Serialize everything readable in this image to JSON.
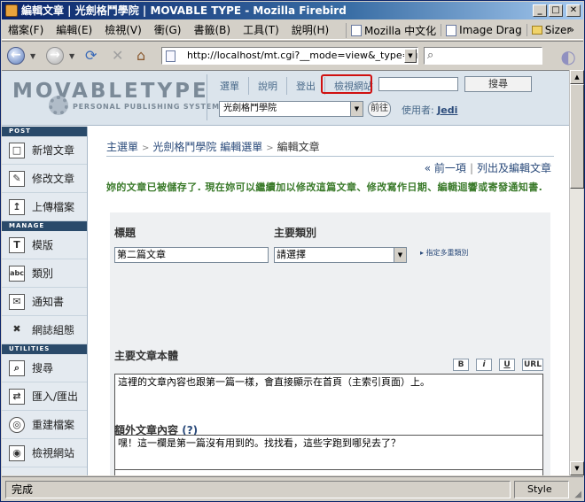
{
  "window": {
    "title": "編輯文章 | 光劍格鬥學院 | MOVABLE TYPE - Mozilla Firebird"
  },
  "menubar": {
    "items": [
      "檔案(F)",
      "編輯(E)",
      "檢視(V)",
      "衝(G)",
      "書籤(B)",
      "工具(T)",
      "說明(H)"
    ],
    "bookmarks": [
      "Mozilla 中文化",
      "Image Drag",
      "Sizer"
    ]
  },
  "navbar": {
    "url": "http://localhost/mt.cgi?__mode=view&_type=entry&"
  },
  "mt_header": {
    "logo": "MOVABLETYPE",
    "logo_sub": "PERSONAL PUBLISHING SYSTEM",
    "links": [
      "選單",
      "說明",
      "登出",
      "檢視網站"
    ],
    "search_button": "搜尋",
    "blog_select": "光劍格鬥學院",
    "go_button": "前往",
    "user_label": "使用者:",
    "user_name": "Jedi"
  },
  "sidebar": {
    "sections": {
      "post": "POST",
      "manage": "MANAGE",
      "utilities": "UTILITIES"
    },
    "post_items": [
      {
        "label": "新增文章",
        "icon": "new-entry-icon"
      },
      {
        "label": "修改文章",
        "icon": "edit-entry-icon"
      },
      {
        "label": "上傳檔案",
        "icon": "upload-icon"
      }
    ],
    "manage_items": [
      {
        "label": "模版",
        "icon": "template-icon"
      },
      {
        "label": "類別",
        "icon": "category-icon"
      },
      {
        "label": "通知書",
        "icon": "notification-icon"
      },
      {
        "label": "網誌組態",
        "icon": "config-icon"
      }
    ],
    "utility_items": [
      {
        "label": "搜尋",
        "icon": "search-icon"
      },
      {
        "label": "匯入/匯出",
        "icon": "import-export-icon"
      },
      {
        "label": "重建檔案",
        "icon": "rebuild-icon"
      },
      {
        "label": "檢視網站",
        "icon": "view-site-icon"
      }
    ]
  },
  "breadcrumb": {
    "main_menu": "主選單",
    "blog_menu": "光劍格鬥學院 編輯選單",
    "current": "編輯文章"
  },
  "entry_nav": {
    "prev": "« 前一項",
    "list": "列出及編輯文章"
  },
  "message": "妳的文章已被儲存了. 現在妳可以繼續加以修改這篇文章、修改寫作日期、編輯迴響或寄發通知書.",
  "form": {
    "title_label": "標題",
    "title_value": "第二篇文章",
    "category_label": "主要類別",
    "category_value": "請選擇",
    "multi_category_link": "指定多重類別",
    "body_label": "主要文章本體",
    "format_buttons": [
      "B",
      "i",
      "U",
      "URL"
    ],
    "body_value": "這裡的文章內容也跟第一篇一樣，會直接顯示在首頁（主索引頁面）上。",
    "extended_label": "額外文章內容",
    "extended_help": "(?)",
    "extended_value": "嘿！這一欄是第一篇沒有用到的。找找看，這些字跑到哪兒去了？"
  },
  "statusbar": {
    "text": "完成",
    "style": "Style"
  }
}
